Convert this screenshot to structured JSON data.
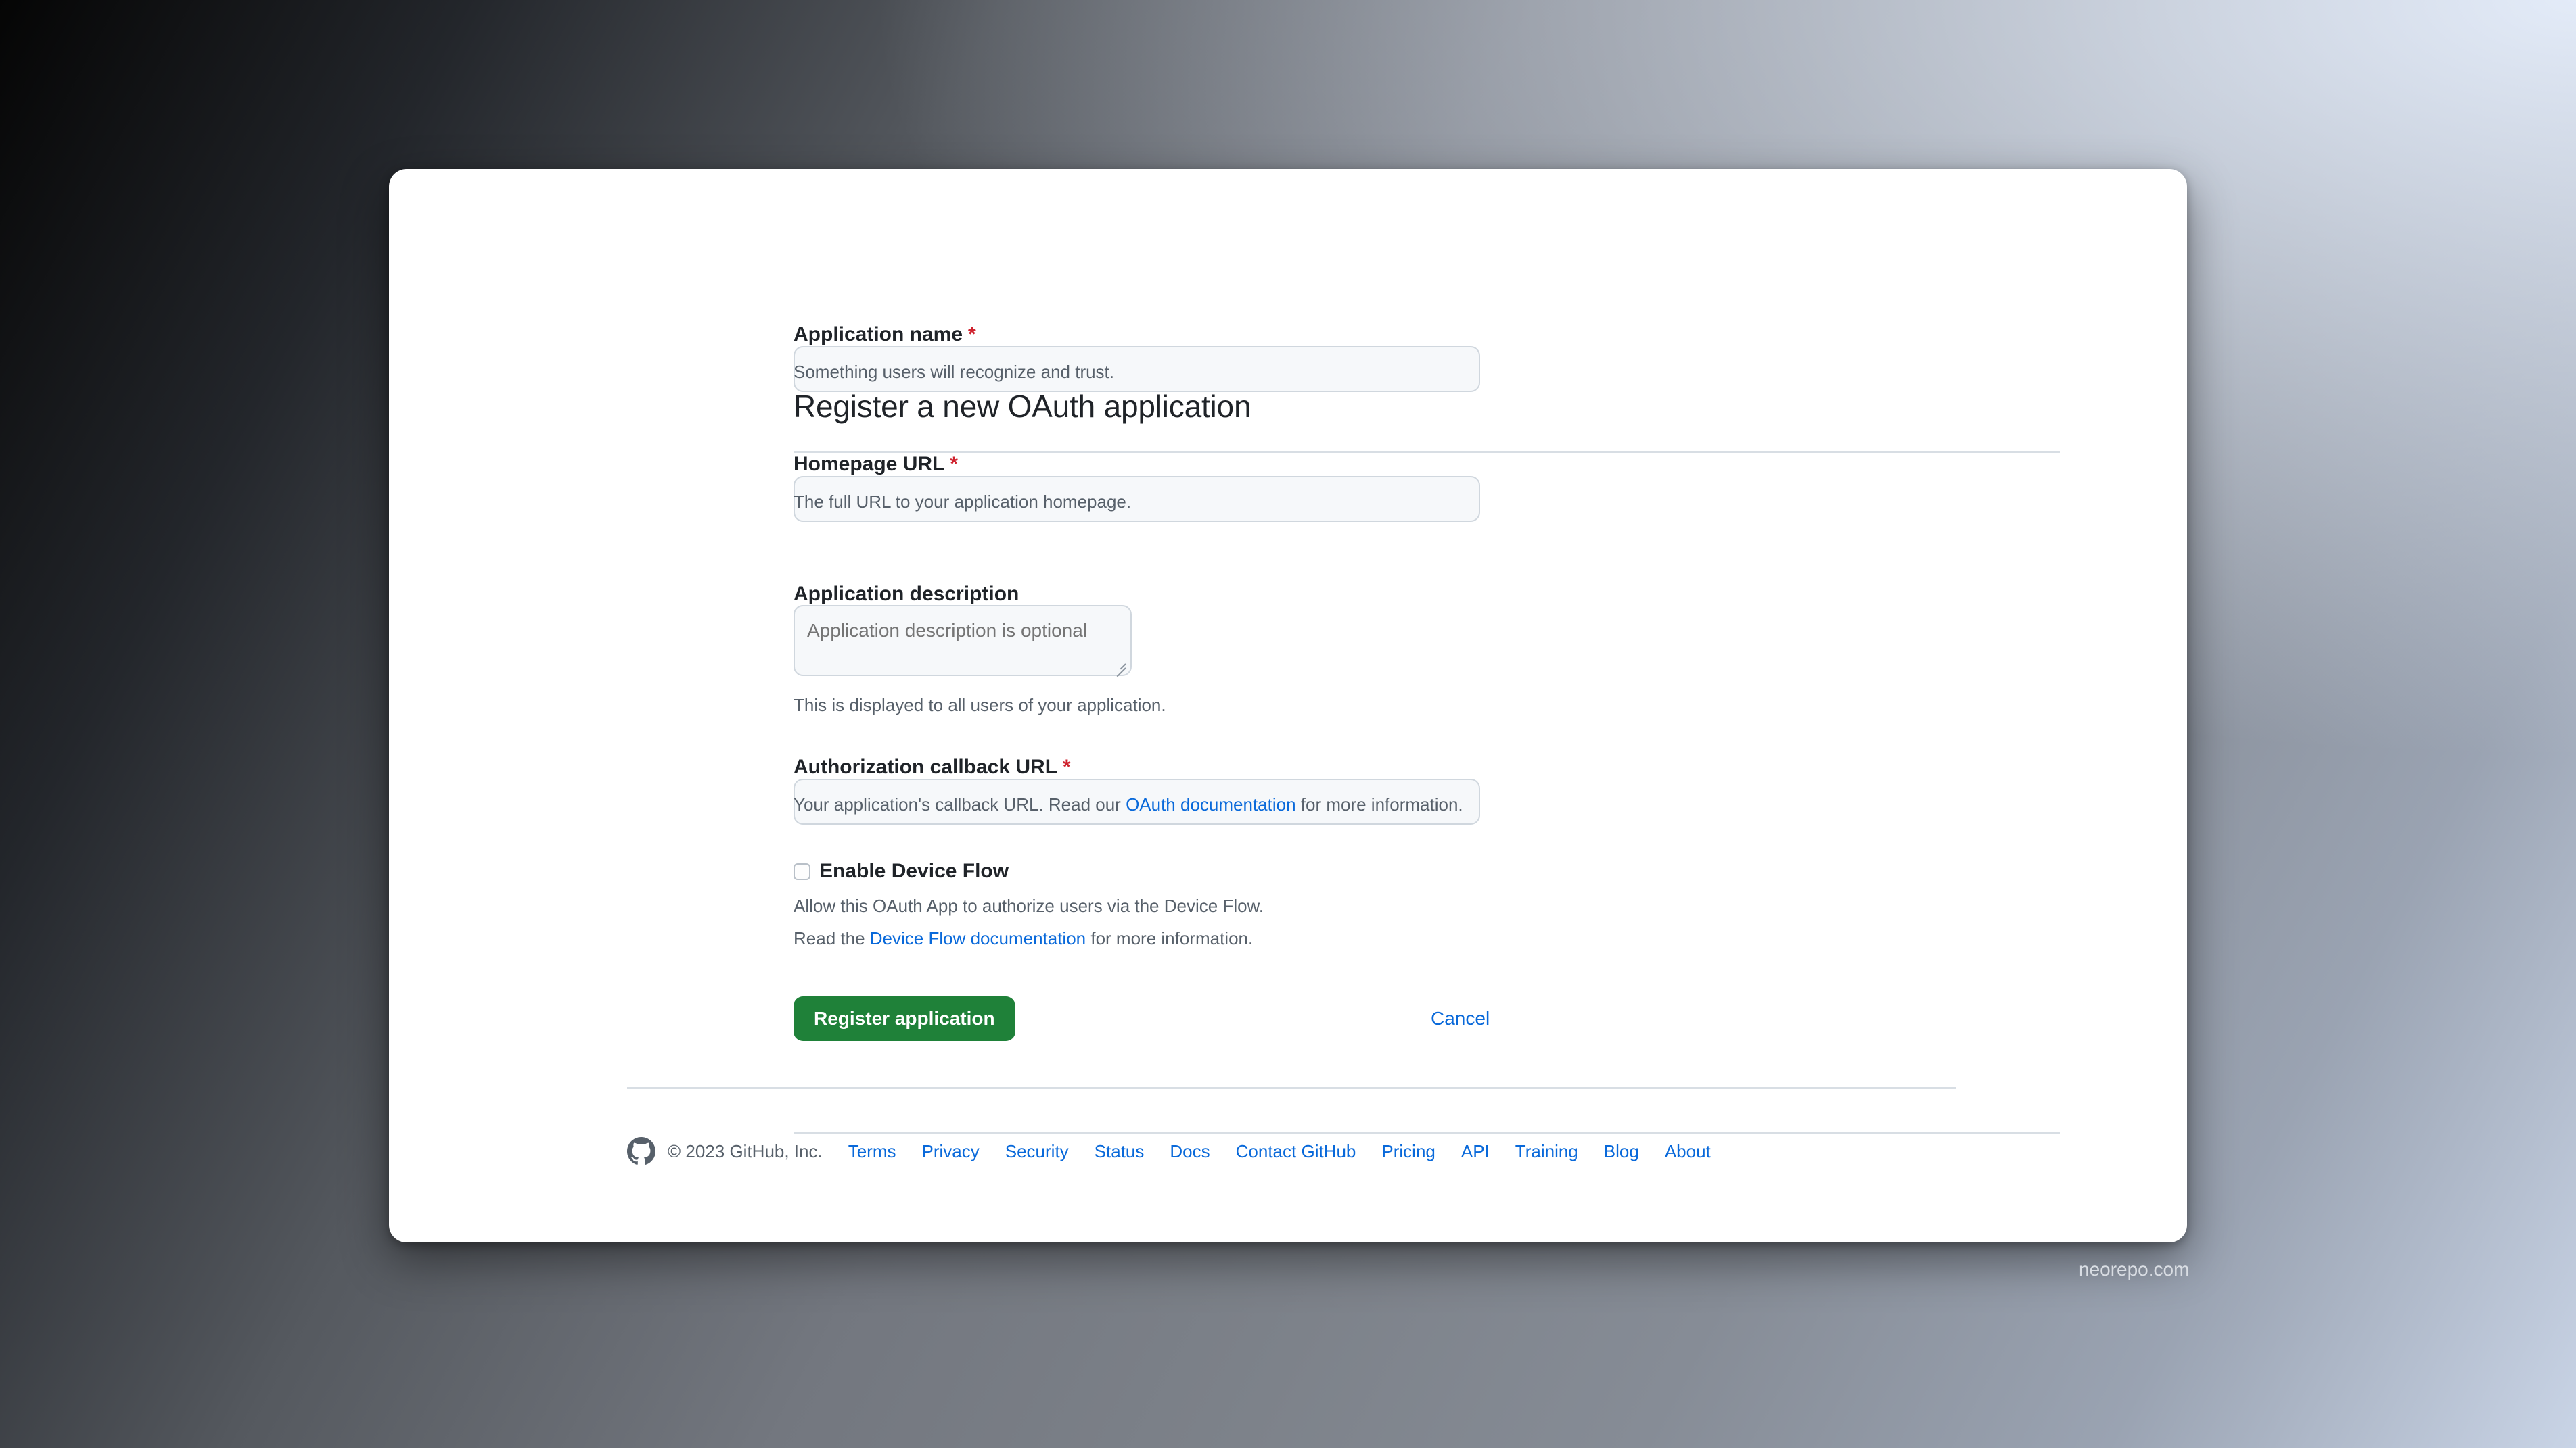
{
  "page": {
    "title": "Register a new OAuth application",
    "watermark": "neorepo.com"
  },
  "form": {
    "fields": [
      {
        "label": "Application name",
        "required_marker": "*",
        "value": "",
        "placeholder": "",
        "help": "Something users will recognize and trust."
      },
      {
        "label": "Homepage URL",
        "required_marker": "*",
        "value": "",
        "placeholder": "",
        "help": "The full URL to your application homepage."
      },
      {
        "label": "Application description",
        "required_marker": "",
        "value": "",
        "placeholder": "Application description is optional",
        "help": "This is displayed to all users of your application."
      },
      {
        "label": "Authorization callback URL",
        "required_marker": "*",
        "value": "",
        "placeholder": "",
        "help_before": "Your application's callback URL. Read our ",
        "help_link": "OAuth documentation",
        "help_after": " for more information."
      }
    ],
    "device_flow": {
      "label": "Enable Device Flow",
      "checked": false,
      "description": "Allow this OAuth App to authorize users via the Device Flow.",
      "read_prefix": "Read the ",
      "read_link": "Device Flow documentation",
      "read_suffix": " for more information."
    },
    "actions": {
      "submit_label": "Register application",
      "cancel_label": "Cancel"
    }
  },
  "footer": {
    "copyright": "© 2023 GitHub, Inc.",
    "links": [
      "Terms",
      "Privacy",
      "Security",
      "Status",
      "Docs",
      "Contact GitHub",
      "Pricing",
      "API",
      "Training",
      "Blog",
      "About"
    ]
  },
  "colors": {
    "accent_link": "#0969da",
    "primary_button": "#1f8139",
    "required_marker": "#cf222e",
    "muted_text": "#57606a"
  }
}
